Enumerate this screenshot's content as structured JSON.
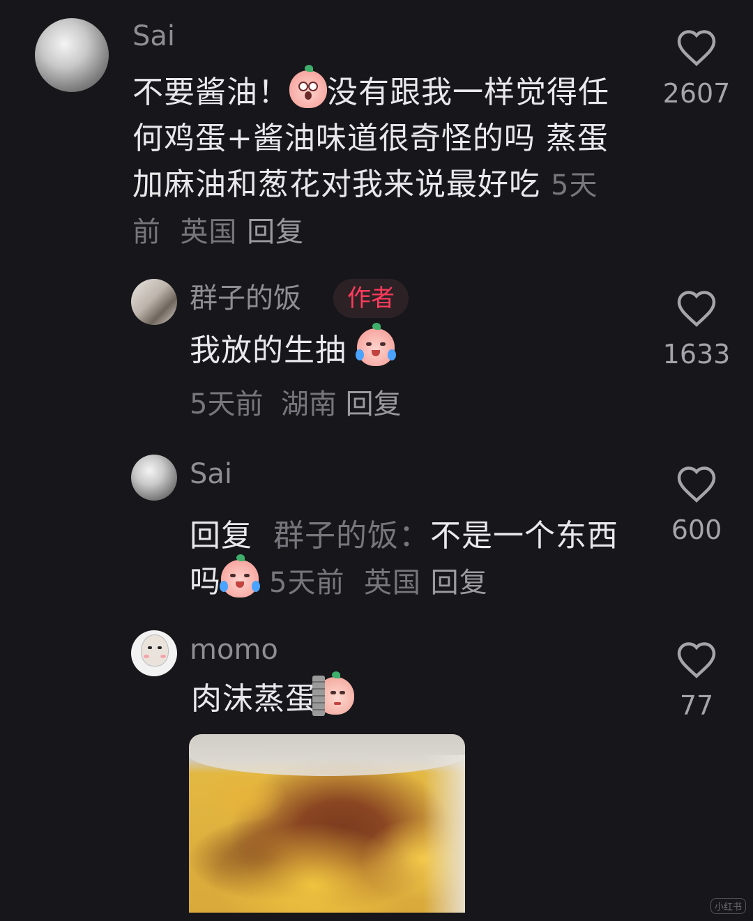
{
  "comments": [
    {
      "username": "Sai",
      "text_1": "不要酱油！",
      "text_2": "没有跟我一样觉得任何鸡蛋+酱油味道很奇怪的吗 蒸蛋加麻油和葱花对我来说最好吃",
      "time": "5天前",
      "location": "英国",
      "reply_label": "回复",
      "likes": "2607"
    },
    {
      "username": "群子的饭",
      "badge": "作者",
      "text": "我放的生抽",
      "time": "5天前",
      "location": "湖南",
      "reply_label": "回复",
      "likes": "1633"
    },
    {
      "username": "Sai",
      "reply_prefix": "回复",
      "reply_target": "群子的饭：",
      "text": "不是一个东西吗",
      "time": "5天前",
      "location": "英国",
      "reply_label": "回复",
      "likes": "600"
    },
    {
      "username": "momo",
      "text": "肉沫蒸蛋",
      "likes": "77"
    }
  ],
  "watermark": "小红书"
}
